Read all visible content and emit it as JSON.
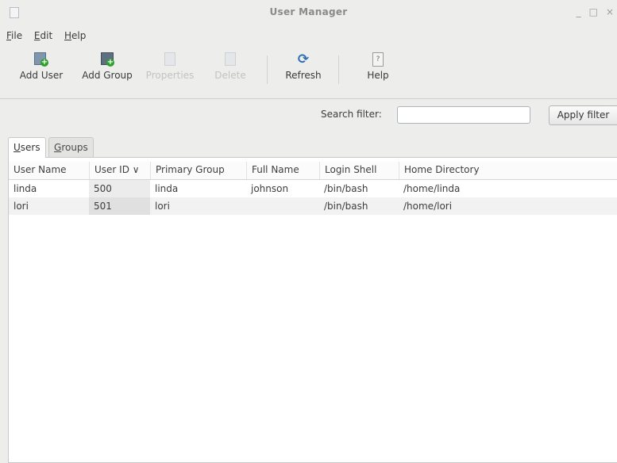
{
  "window": {
    "title": "User Manager"
  },
  "menu": {
    "file": "File",
    "edit": "Edit",
    "help": "Help"
  },
  "toolbar": {
    "add_user": "Add User",
    "add_group": "Add Group",
    "properties": "Properties",
    "delete": "Delete",
    "refresh": "Refresh",
    "help": "Help"
  },
  "search": {
    "label": "Search filter:",
    "value": "",
    "apply": "Apply filter"
  },
  "tabs": {
    "users": "Users",
    "groups": "Groups"
  },
  "table": {
    "columns": [
      "User Name",
      "User ID ∨",
      "Primary Group",
      "Full Name",
      "Login Shell",
      "Home Directory"
    ],
    "rows": [
      [
        "linda",
        "500",
        "linda",
        "johnson",
        "/bin/bash",
        "/home/linda"
      ],
      [
        "lori",
        "501",
        "lori",
        "",
        "/bin/bash",
        "/home/lori"
      ]
    ]
  }
}
